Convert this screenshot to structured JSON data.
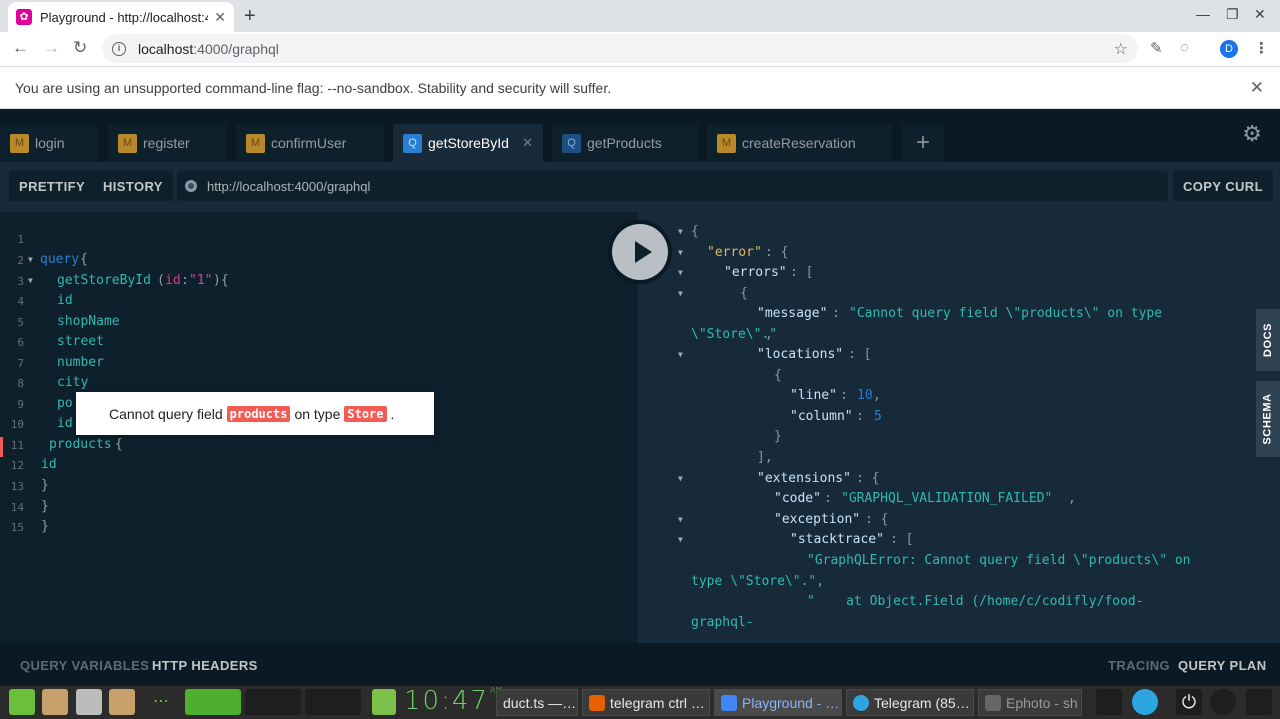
{
  "browser": {
    "tab_title": "Playground - http://localhost:4000/graphql",
    "tab_favicon": "graphql-icon",
    "address_host": "localhost",
    "address_path": ":4000/graphql",
    "profile_initial": "D",
    "infobar_message": "You are using an unsupported command-line flag: --no-sandbox. Stability and security will suffer."
  },
  "playground": {
    "tabs": [
      {
        "type": "M",
        "label": "login"
      },
      {
        "type": "M",
        "label": "register"
      },
      {
        "type": "M",
        "label": "confirmUser"
      },
      {
        "type": "Q",
        "label": "getStoreById",
        "active": true
      },
      {
        "type": "Q",
        "label": "getProducts"
      },
      {
        "type": "M",
        "label": "createReservation"
      }
    ],
    "prettify_label": "PRETTIFY",
    "history_label": "HISTORY",
    "endpoint": "http://localhost:4000/graphql",
    "copy_curl_label": "COPY CURL",
    "side_tabs": {
      "docs": "DOCS",
      "schema": "SCHEMA"
    },
    "bottom": {
      "query_variables": "QUERY VARIABLES",
      "http_headers": "HTTP HEADERS",
      "tracing": "TRACING",
      "query_plan": "QUERY PLAN"
    },
    "tooltip": {
      "prefix": "Cannot query field",
      "field": "products",
      "middle": "on type",
      "type": "Store",
      "suffix": "."
    },
    "editor_lines": [
      "1",
      "2",
      "3",
      "4",
      "5",
      "6",
      "7",
      "8",
      "9",
      "10",
      "11",
      "12",
      "13",
      "14",
      "15"
    ],
    "query": {
      "kw_query": "query",
      "op_name": "getStoreById",
      "arg_name": "id",
      "arg_value": "\"1\"",
      "fields": [
        "id",
        "shopName",
        "street",
        "number",
        "city",
        "po",
        "id"
      ],
      "error_field": "products",
      "nested_field": "id"
    },
    "response": {
      "error_key": "\"error\"",
      "errors_key": "\"errors\"",
      "message_key": "\"message\"",
      "message_value": "\"Cannot query field \\\"products\\\" on type",
      "message_value_cont": "\\\"Store\\\".\"",
      "locations_key": "\"locations\"",
      "line_key": "\"line\"",
      "line_value": "10",
      "column_key": "\"column\"",
      "column_value": "5",
      "extensions_key": "\"extensions\"",
      "code_key": "\"code\"",
      "code_value": "\"GRAPHQL_VALIDATION_FAILED\"",
      "exception_key": "\"exception\"",
      "stacktrace_key": "\"stacktrace\"",
      "stack_1a": "\"GraphQLError: Cannot query field \\\"products\\\" on",
      "stack_1b": "type \\\"Store\\\".\",",
      "stack_2a": "\"    at Object.Field (/home/c/codifly/food-",
      "stack_2b": "graphql-"
    }
  },
  "taskbar": {
    "clock": "10:47",
    "clock_ampm": "AM",
    "windows": [
      {
        "label": "duct.ts —…",
        "color": "#3a3a3a"
      },
      {
        "label": "telegram ctrl …",
        "color": "#e66000"
      },
      {
        "label": "Playground - …",
        "color": "#4285f4"
      },
      {
        "label": "Telegram (85…",
        "color": "#2ca5e0"
      },
      {
        "label": "Ephoto - sh",
        "color": "#666666"
      }
    ]
  }
}
